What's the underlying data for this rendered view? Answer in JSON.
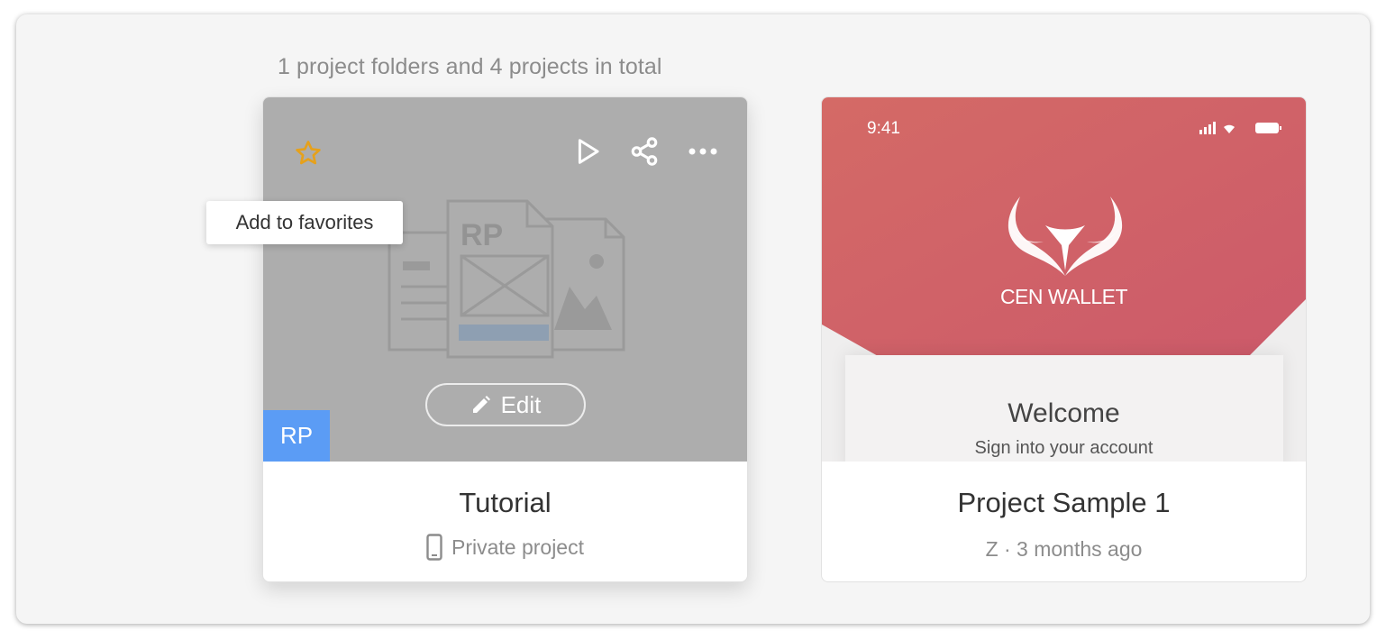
{
  "summary": "1 project folders and 4 projects in total",
  "tooltip": "Add to favorites",
  "projects": [
    {
      "title": "Tutorial",
      "subtitle": "Private project",
      "edit_label": "Edit",
      "badge": "RP",
      "thumb_doc_label": "RP",
      "icons": [
        "star-icon",
        "play-icon",
        "share-icon",
        "more-icon",
        "pencil-icon",
        "phone-icon"
      ]
    },
    {
      "title": "Project Sample 1",
      "subtitle": "Z · 3 months ago",
      "preview": {
        "status_time": "9:41",
        "app_name": "CEN WALLET",
        "welcome": "Welcome",
        "signin": "Sign into your account"
      }
    }
  ],
  "colors": {
    "frame_bg": "#f5f5f5",
    "thumb_gray": "#adadad",
    "badge_blue": "#5b9cf5",
    "star_orange": "#e6a11b",
    "wallet_red": "#d1626a"
  }
}
